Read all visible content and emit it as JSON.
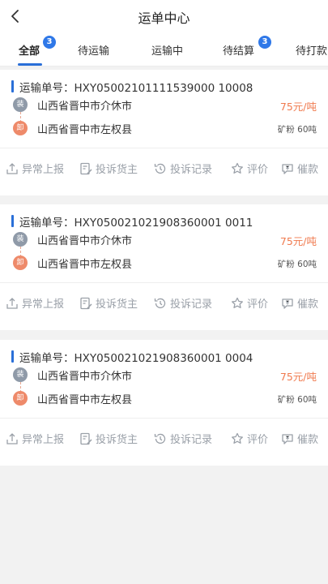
{
  "header": {
    "title": "运单中心"
  },
  "tabs": [
    {
      "label": "全部",
      "badge": "3"
    },
    {
      "label": "待运输"
    },
    {
      "label": "运输中"
    },
    {
      "label": "待结算",
      "badge": "3"
    },
    {
      "label": "待打款"
    }
  ],
  "orders": [
    {
      "order_label": "运输单号：",
      "order_no": "HXY05002101111539000 10008",
      "load_tag": "装",
      "unload_tag": "卸",
      "from": "山西省晋中市介休市",
      "to": "山西省晋中市左权县",
      "price": "75元/吨",
      "cargo": "矿粉 60吨"
    },
    {
      "order_label": "运输单号：",
      "order_no": "HXY050021021908360001 0011",
      "load_tag": "装",
      "unload_tag": "卸",
      "from": "山西省晋中市介休市",
      "to": "山西省晋中市左权县",
      "price": "75元/吨",
      "cargo": "矿粉 60吨"
    },
    {
      "order_label": "运输单号：",
      "order_no": "HXY050021021908360001 0004",
      "load_tag": "装",
      "unload_tag": "卸",
      "from": "山西省晋中市介休市",
      "to": "山西省晋中市左权县",
      "price": "75元/吨",
      "cargo": "矿粉 60吨"
    }
  ],
  "actions": [
    {
      "label": "异常上报",
      "icon": "upload-icon"
    },
    {
      "label": "投诉货主",
      "icon": "edit-doc-icon"
    },
    {
      "label": "投诉记录",
      "icon": "history-icon"
    },
    {
      "label": "评价",
      "icon": "review-icon"
    },
    {
      "label": "催款",
      "icon": "yuan-bubble-icon"
    }
  ]
}
